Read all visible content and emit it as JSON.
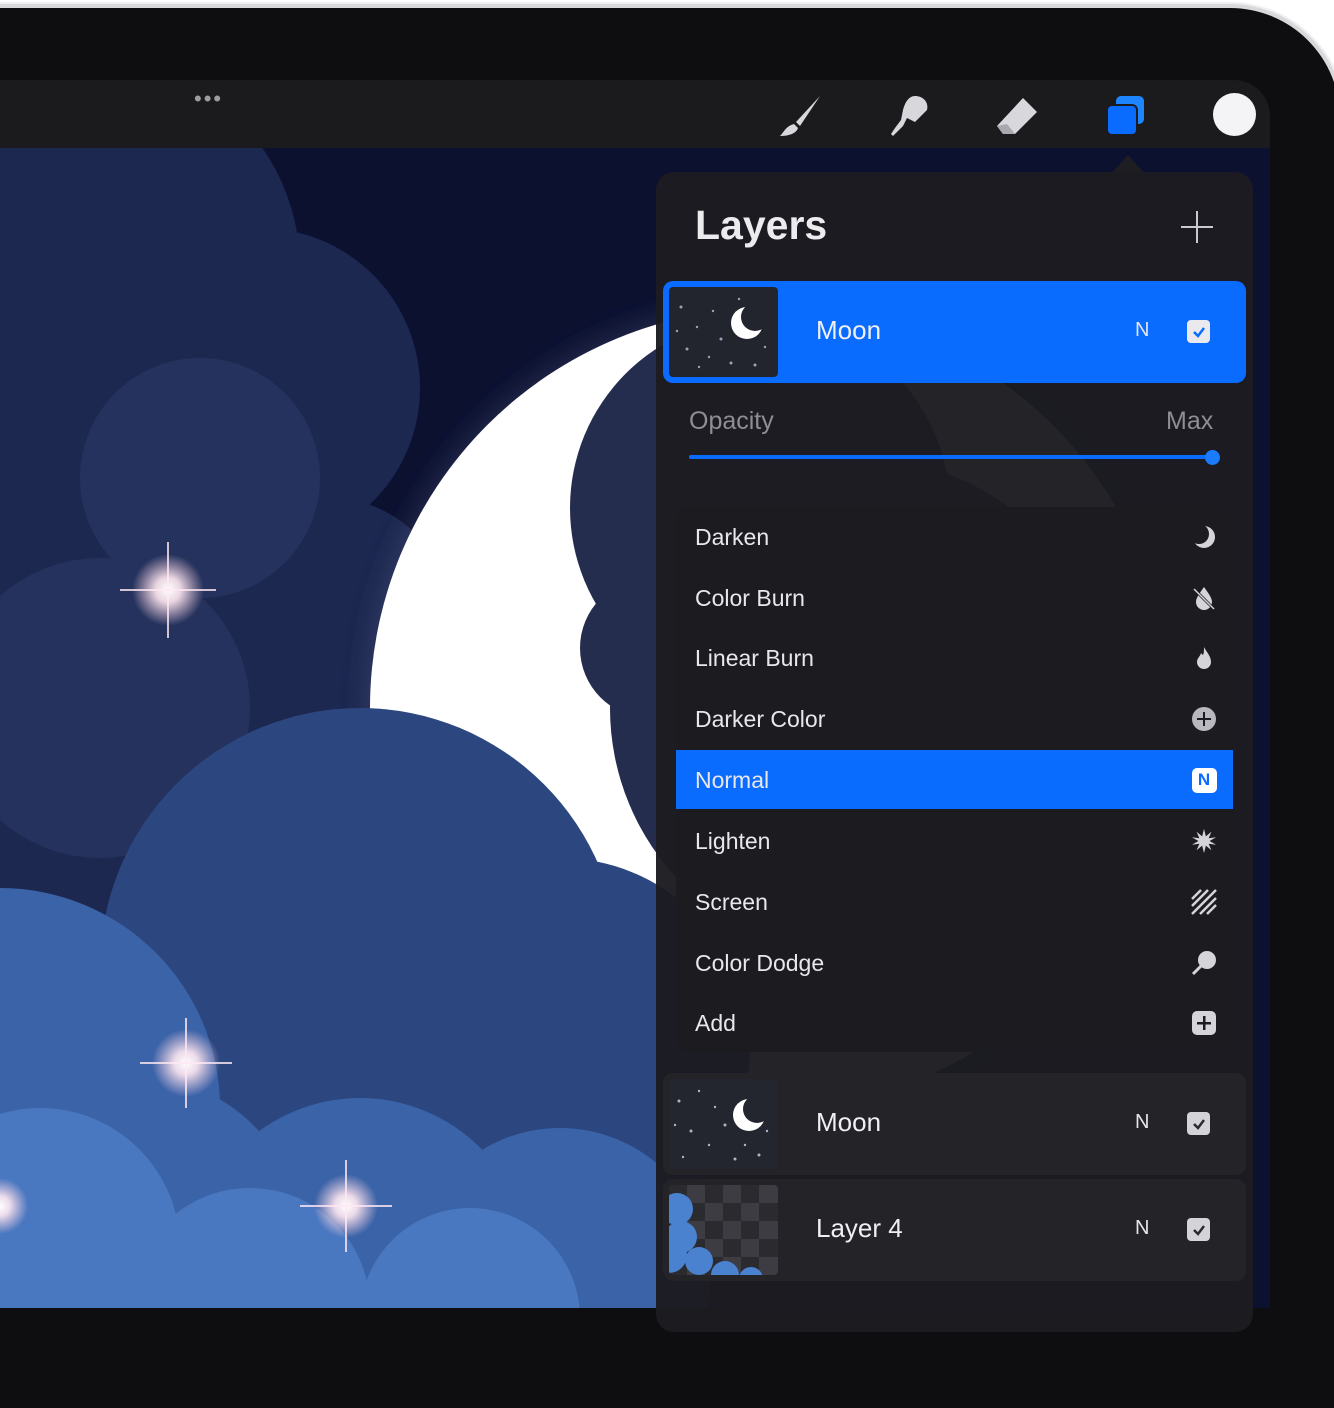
{
  "toolbar": {
    "more_label": "•••",
    "tools": [
      {
        "name": "brush-icon"
      },
      {
        "name": "smudge-icon"
      },
      {
        "name": "eraser-icon"
      },
      {
        "name": "layers-icon"
      }
    ],
    "color_swatch": "#f4f4f6"
  },
  "layers_panel": {
    "title": "Layers",
    "add_icon": "plus-icon",
    "active_layer": {
      "name": "Moon",
      "mode": "N",
      "visible": true
    },
    "opacity": {
      "label": "Opacity",
      "value": "Max",
      "level": 1.0
    },
    "blend_modes": [
      {
        "label": "Darken",
        "icon": "crescent-icon",
        "selected": false
      },
      {
        "label": "Color Burn",
        "icon": "burn-drop-icon",
        "selected": false
      },
      {
        "label": "Linear Burn",
        "icon": "flame-icon",
        "selected": false
      },
      {
        "label": "Darker Color",
        "icon": "plus-circle-icon",
        "selected": false
      },
      {
        "label": "Normal",
        "icon": "n-badge-icon",
        "selected": true,
        "badge": "N"
      },
      {
        "label": "Lighten",
        "icon": "sunburst-icon",
        "selected": false
      },
      {
        "label": "Screen",
        "icon": "hatch-icon",
        "selected": false
      },
      {
        "label": "Color Dodge",
        "icon": "dodge-icon",
        "selected": false
      },
      {
        "label": "Add",
        "icon": "plus-square-icon",
        "selected": false
      }
    ],
    "layers": [
      {
        "name": "Moon",
        "mode": "N",
        "visible": true
      },
      {
        "name": "Layer 4",
        "mode": "N",
        "visible": true
      }
    ]
  },
  "colors": {
    "accent": "#0a6cff",
    "panel": "#1c1c21"
  }
}
